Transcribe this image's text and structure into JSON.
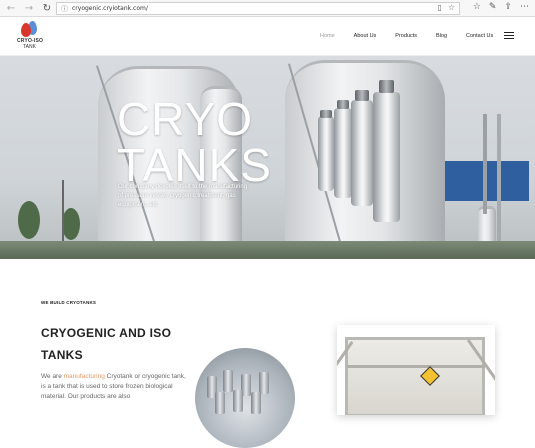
{
  "browser": {
    "url": "cryogenic.cryiotank.com/",
    "back_glyph": "←",
    "forward_glyph": "→",
    "reload_glyph": "↻"
  },
  "header": {
    "logo_line1": "CRYO-ISO",
    "logo_line2": "TANK",
    "menu": [
      {
        "label": "Home",
        "active": true
      },
      {
        "label": "About Us",
        "active": false
      },
      {
        "label": "Products",
        "active": false
      },
      {
        "label": "Blog",
        "active": false
      },
      {
        "label": "Contact Us",
        "active": false
      }
    ]
  },
  "hero": {
    "title_line1": "CRYO",
    "title_line2": "TANKS",
    "description": "Our company devotes itself to the manufacturing of pressure vessel, cryogenic treatment, gas equipment, etc"
  },
  "about": {
    "eyebrow": "WE BUILD CRYOTANKS",
    "title": "CRYOGENIC AND ISO TANKS",
    "body_prefix": "We are ",
    "body_highlight": "manufacturing",
    "body_suffix": " Cryotank or cryogenic tank, is a tank that is used to store frozen biological material. Our products are also"
  },
  "colors": {
    "accent": "#e89a6a",
    "logo_red": "#d9362c",
    "logo_blue": "#3f7bd1"
  }
}
